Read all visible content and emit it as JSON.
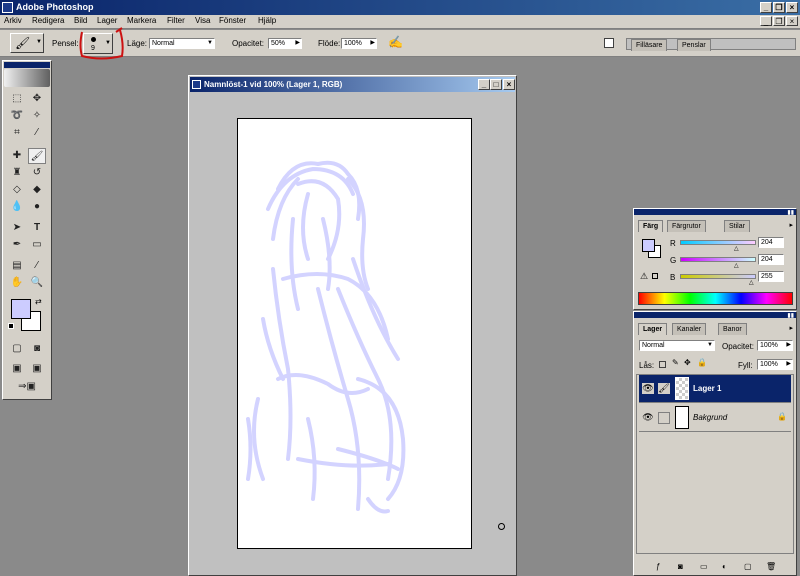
{
  "app": {
    "title": "Adobe Photoshop"
  },
  "menu": [
    "Arkiv",
    "Redigera",
    "Bild",
    "Lager",
    "Markera",
    "Filter",
    "Visa",
    "Fönster",
    "Hjälp"
  ],
  "options": {
    "brush_label": "Pensel:",
    "brush_size": "9",
    "mode_label": "Läge:",
    "mode_value": "Normal",
    "opacity_label": "Opacitet:",
    "opacity_value": "50%",
    "flow_label": "Flöde:",
    "flow_value": "100%",
    "palette_tabs": [
      "Filläsare",
      "Penslar"
    ]
  },
  "document": {
    "title": "Namnlöst-1 vid 100% (Lager 1, RGB)"
  },
  "color_panel": {
    "tabs": [
      "Färg",
      "Färgrutor",
      "Stilar"
    ],
    "channels": [
      {
        "label": "R",
        "value": "204"
      },
      {
        "label": "G",
        "value": "204"
      },
      {
        "label": "B",
        "value": "255"
      }
    ],
    "foreground": "#ccccff"
  },
  "layers_panel": {
    "tabs": [
      "Lager",
      "Kanaler",
      "Banor"
    ],
    "mode_value": "Normal",
    "opacity_label": "Opacitet:",
    "opacity_value": "100%",
    "lock_label": "Lås:",
    "fill_label": "Fyll:",
    "fill_value": "100%",
    "layers": [
      {
        "name": "Lager 1",
        "selected": true
      },
      {
        "name": "Bakgrund",
        "selected": false
      }
    ]
  },
  "colors": {
    "accent": "#0a246a",
    "sketch": "#ccccff"
  }
}
